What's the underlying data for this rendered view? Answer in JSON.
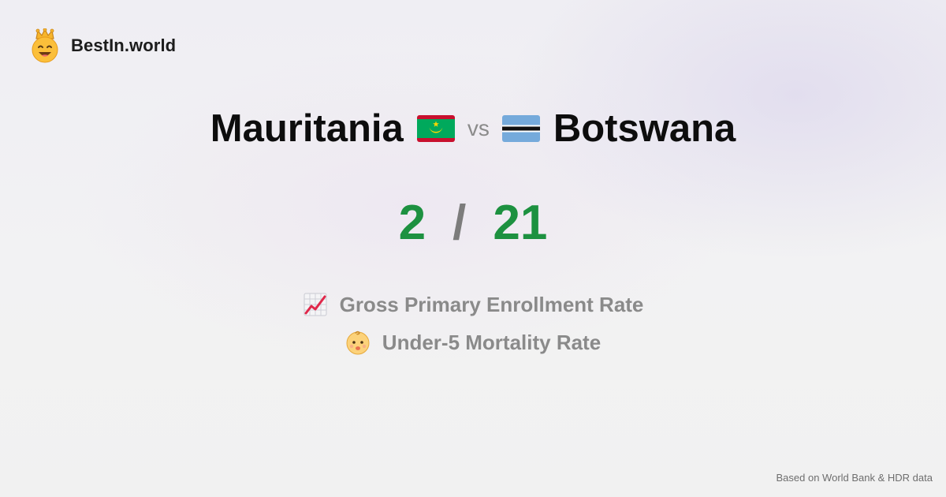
{
  "brand": {
    "name": "BestIn.world",
    "logo_icon": "crowned-smiley-icon"
  },
  "comparison": {
    "left_country": "Mauritania",
    "left_flag_icon": "mauritania-flag-icon",
    "vs_label": "vs",
    "right_country": "Botswana",
    "right_flag_icon": "botswana-flag-icon"
  },
  "score": {
    "left": "2",
    "separator": "/",
    "right": "21",
    "color": "#1d9140"
  },
  "metrics": [
    {
      "icon": "chart-increasing-icon",
      "label": "Gross Primary Enrollment Rate"
    },
    {
      "icon": "baby-face-icon",
      "label": "Under-5 Mortality Rate"
    }
  ],
  "footer": {
    "source_note": "Based on World Bank & HDR data"
  }
}
